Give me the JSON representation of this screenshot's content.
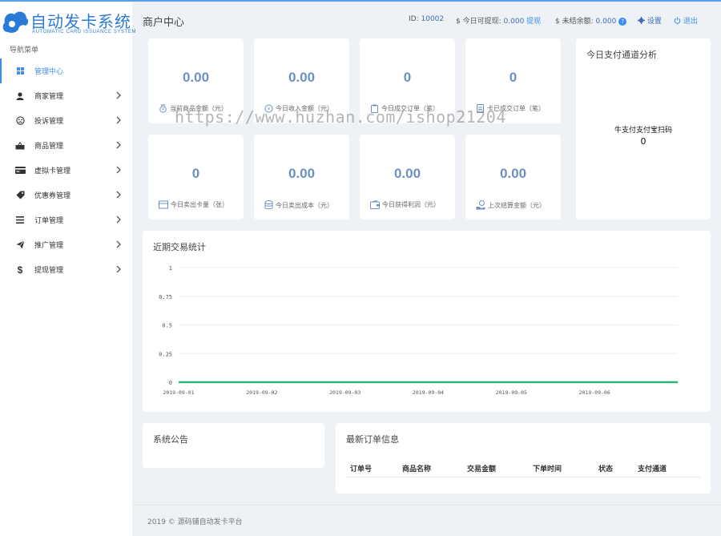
{
  "brand": {
    "title": "自动发卡系统",
    "subtitle": "AUTOMATIC CARD ISSUANCE SYSTEM"
  },
  "sidebar": {
    "header": "导航菜单",
    "items": [
      {
        "label": "管理中心",
        "icon": "dashboard-icon"
      },
      {
        "label": "商家管理",
        "icon": "user-icon"
      },
      {
        "label": "投诉管理",
        "icon": "frown-icon"
      },
      {
        "label": "商品管理",
        "icon": "basket-icon"
      },
      {
        "label": "虚拟卡管理",
        "icon": "credit-card-icon"
      },
      {
        "label": "优惠券管理",
        "icon": "tag-icon"
      },
      {
        "label": "订单管理",
        "icon": "list-icon"
      },
      {
        "label": "推广管理",
        "icon": "paper-plane-icon"
      },
      {
        "label": "提现管理",
        "icon": "dollar-icon"
      }
    ]
  },
  "header": {
    "page_title": "商户中心",
    "id_label": "ID:",
    "id_value": "10002",
    "withdrawable_label": "今日可提现:",
    "withdrawable_value": "0.000",
    "withdraw_link": "提现",
    "unsettled_label": "未结余额:",
    "unsettled_value": "0.000",
    "settings_label": "设置",
    "logout_label": "退出"
  },
  "stats": [
    {
      "value": "0.00",
      "label": "当前商品金额（元）"
    },
    {
      "value": "0.00",
      "label": "今日收入金额（元）"
    },
    {
      "value": "0",
      "label": "今日成交订单（笔）"
    },
    {
      "value": "0",
      "label": "卡已成交订单（笔）"
    },
    {
      "value": "0",
      "label": "今日卖出卡量（张）"
    },
    {
      "value": "0.00",
      "label": "今日卖出成本（元）"
    },
    {
      "value": "0.00",
      "label": "今日获得利润（元）"
    },
    {
      "value": "0.00",
      "label": "上次结算金额（元）"
    }
  ],
  "pay_panel": {
    "title": "今日支付通道分析",
    "channel": "牛支付支付宝扫码",
    "value": "0"
  },
  "chart_panel": {
    "title": "近期交易统计"
  },
  "chart_data": {
    "type": "line",
    "x": [
      "2019-09-01",
      "2019-09-02",
      "2019-09-03",
      "2019-09-04",
      "2019-09-05",
      "2019-09-06"
    ],
    "y_ticks": [
      "1",
      "0.75",
      "0.5",
      "0.25",
      "0"
    ],
    "ylim": [
      0,
      1
    ],
    "series": [
      {
        "values": [
          0,
          0,
          0,
          0,
          0,
          0,
          0
        ],
        "color": "#2bb673"
      }
    ],
    "grid": true
  },
  "notice_panel": {
    "title": "系统公告"
  },
  "orders_panel": {
    "title": "最新订单信息",
    "columns": [
      "订单号",
      "商品名称",
      "交易金额",
      "下单时间",
      "状态",
      "支付通道"
    ]
  },
  "footer": {
    "text": "2019 © 源码铺自动发卡平台"
  },
  "watermark": "https://www.huzhan.com/ishop21204",
  "colors": {
    "accent": "#3d8ee8",
    "value_blue": "#6d8fc5",
    "line_green": "#2bb673"
  }
}
